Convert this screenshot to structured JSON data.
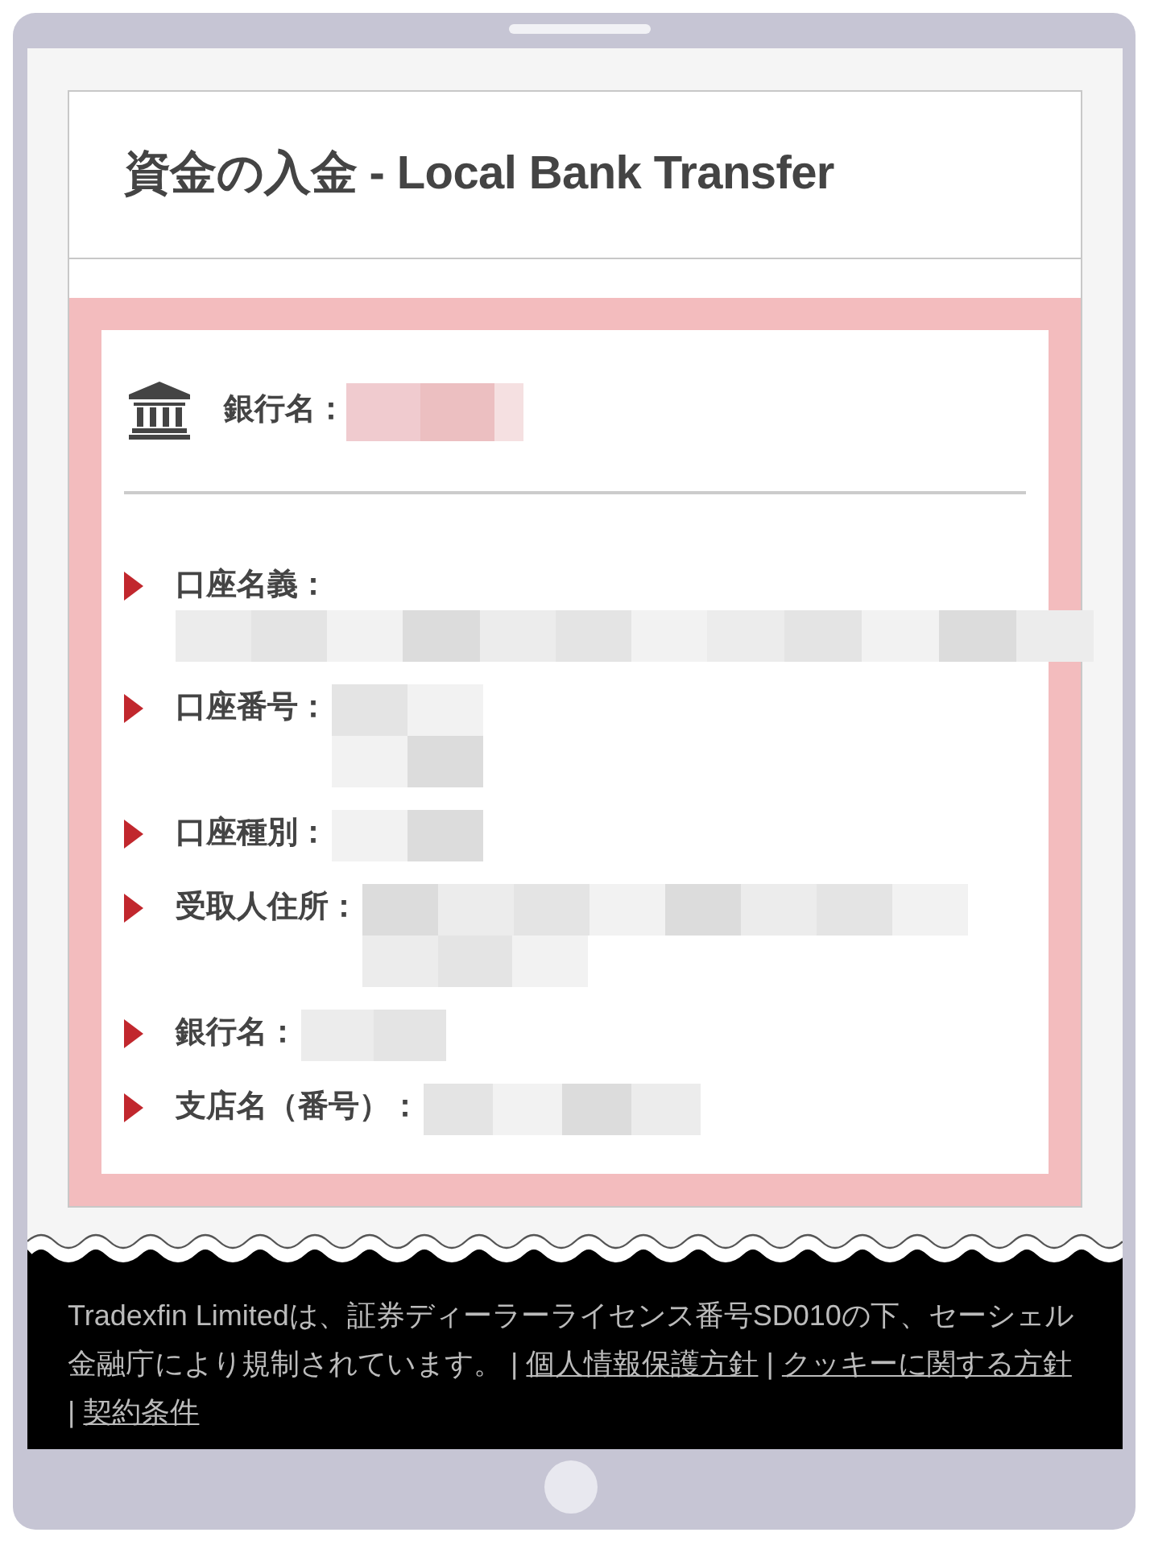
{
  "header": {
    "title": "資金の入金 - Local Bank Transfer"
  },
  "bank": {
    "label": "銀行名："
  },
  "details": [
    {
      "label": "口座名義："
    },
    {
      "label": "口座番号："
    },
    {
      "label": "口座種別："
    },
    {
      "label": "受取人住所："
    },
    {
      "label": "銀行名："
    },
    {
      "label": "支店名（番号）："
    }
  ],
  "footer": {
    "text": "Tradexfin Limitedは、証券ディーラーライセンス番号SD010の下、セーシェル金融庁により規制されています。",
    "separator": "|",
    "links": [
      "個人情報保護方針",
      "クッキーに関する方針",
      "契約条件"
    ]
  }
}
